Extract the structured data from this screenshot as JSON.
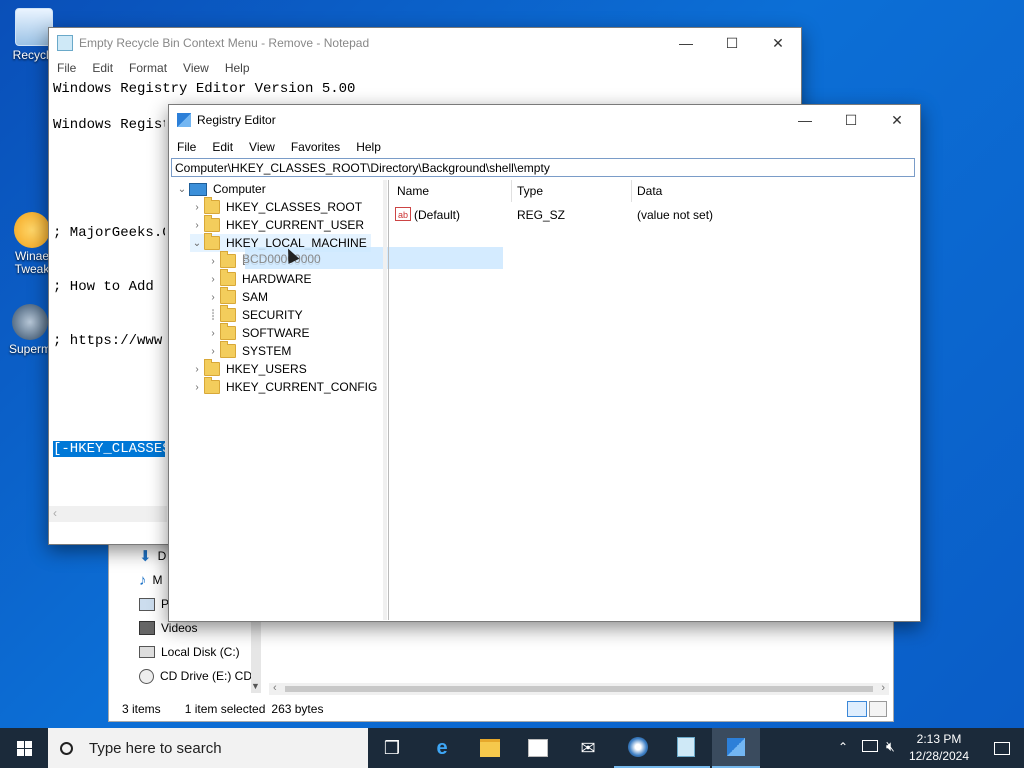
{
  "desktop": {
    "icons": [
      {
        "label": "Recycle"
      },
      {
        "label": "Winae\nTweak"
      },
      {
        "label": "Superm"
      }
    ]
  },
  "notepad": {
    "title": "Empty Recycle Bin Context Menu - Remove - Notepad",
    "menu": [
      "File",
      "Edit",
      "Format",
      "View",
      "Help"
    ],
    "lines": [
      "Windows Registry Editor Version 5.00",
      "",
      "; MajorGeeks.Co",
      "; How to Add 'E",
      "; https://www.m",
      "",
      "[-HKEY_CLASSES_"
    ]
  },
  "explorer": {
    "nav_items": [
      "D",
      "M",
      "P",
      "Videos",
      "Local Disk (C:)",
      "CD Drive (E:) CDF"
    ],
    "status": {
      "items": "3 items",
      "selected": "1 item selected",
      "size": "263 bytes"
    }
  },
  "regedit": {
    "title": "Registry Editor",
    "menu": [
      "File",
      "Edit",
      "View",
      "Favorites",
      "Help"
    ],
    "address": "Computer\\HKEY_CLASSES_ROOT\\Directory\\Background\\shell\\empty",
    "tree": {
      "root": "Computer",
      "hives": [
        "HKEY_CLASSES_ROOT",
        "HKEY_CURRENT_USER",
        "HKEY_LOCAL_MACHINE"
      ],
      "hklm_children": [
        "BCD00000000",
        "HARDWARE",
        "SAM",
        "SECURITY",
        "SOFTWARE",
        "SYSTEM"
      ],
      "more_hives": [
        "HKEY_USERS",
        "HKEY_CURRENT_CONFIG"
      ]
    },
    "columns": [
      "Name",
      "Type",
      "Data"
    ],
    "values": [
      {
        "name": "(Default)",
        "type": "REG_SZ",
        "data": "(value not set)"
      }
    ]
  },
  "taskbar": {
    "search_placeholder": "Type here to search",
    "time": "2:13 PM",
    "date": "12/28/2024"
  },
  "colors": {
    "desktop": "#0a5cc6",
    "taskbar": "#1b2a3a",
    "selection": "#cce8ff",
    "highlight": "#0078d7"
  }
}
